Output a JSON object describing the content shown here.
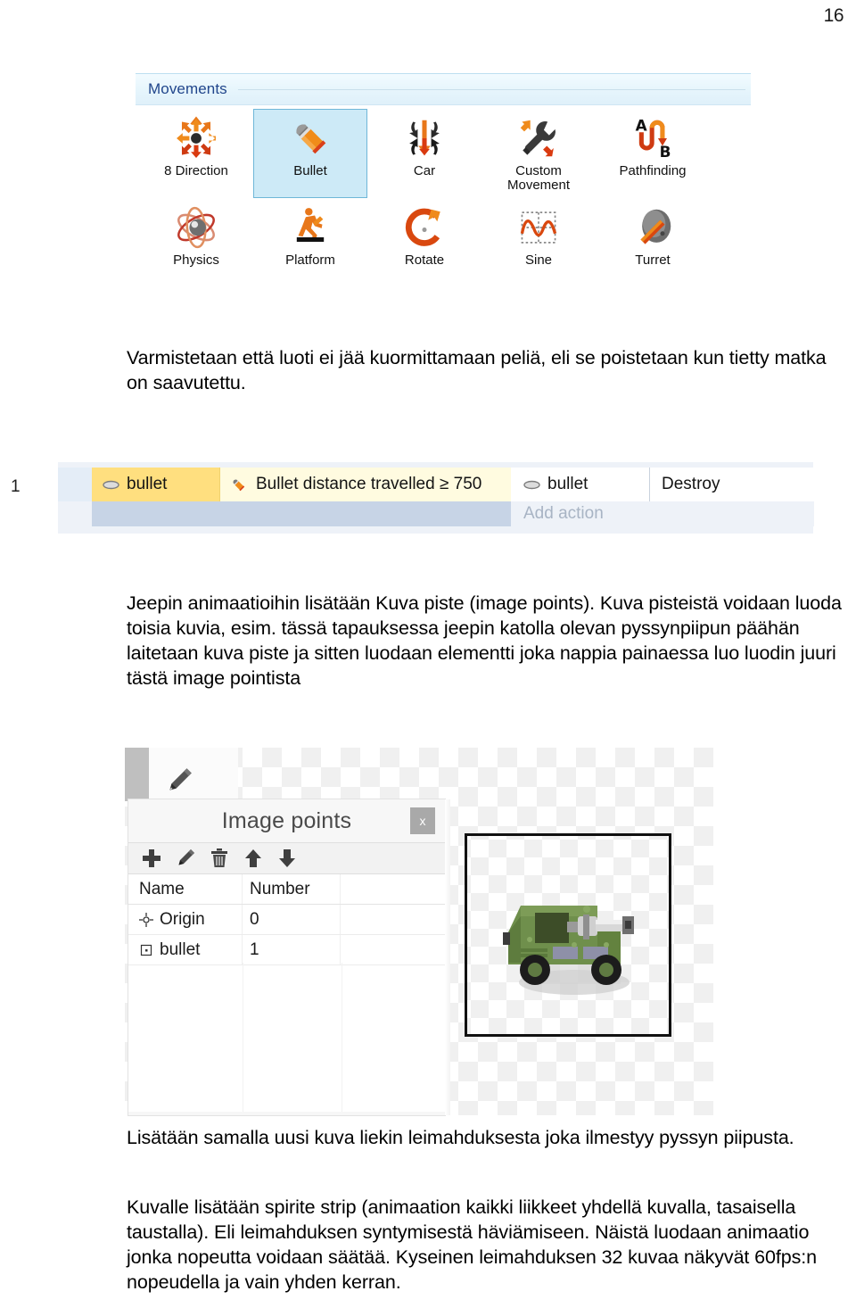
{
  "page": {
    "number": "16"
  },
  "movements_panel": {
    "header": "Movements",
    "items": [
      {
        "label": "8 Direction",
        "icon": "eight-direction-icon",
        "selected": false
      },
      {
        "label": "Bullet",
        "icon": "bullet-icon",
        "selected": true
      },
      {
        "label": "Car",
        "icon": "car-icon",
        "selected": false
      },
      {
        "label": "Custom\nMovement",
        "icon": "custom-movement-icon",
        "selected": false
      },
      {
        "label": "Pathfinding",
        "icon": "pathfinding-icon",
        "selected": false
      },
      {
        "label": "Physics",
        "icon": "physics-icon",
        "selected": false
      },
      {
        "label": "Platform",
        "icon": "platform-icon",
        "selected": false
      },
      {
        "label": "Rotate",
        "icon": "rotate-icon",
        "selected": false
      },
      {
        "label": "Sine",
        "icon": "sine-icon",
        "selected": false
      },
      {
        "label": "Turret",
        "icon": "turret-icon",
        "selected": false
      }
    ]
  },
  "paragraphs": {
    "p1": "Varmistetaan että luoti ei jää kuormittamaan peliä, eli se poistetaan kun tietty matka on saavutettu.",
    "p2": "Jeepin animaatioihin lisätään Kuva piste (image points). Kuva pisteistä voidaan luoda toisia kuvia, esim. tässä tapauksessa jeepin katolla olevan pyssynpiipun päähän laitetaan kuva piste ja sitten luodaan elementti joka nappia painaessa luo luodin juuri tästä image pointista",
    "p3": "Lisätään samalla uusi kuva liekin leimahduksesta joka ilmestyy pyssyn piipusta.",
    "p4": "Kuvalle lisätään spirite strip (animaation kaikki liikkeet yhdellä kuvalla, tasaisella taustalla). Eli leimahduksen syntymisestä häviämiseen. Näistä luodaan animaatio jonka nopeutta voidaan säätää. Kyseinen leimahduksen 32 kuvaa näkyvät 60fps:n nopeudella ja vain yhden kerran."
  },
  "event_sheet": {
    "event_number": "1",
    "condition": {
      "object": "bullet",
      "object_icon": "bullet-object-icon",
      "text": "Bullet distance travelled ≥ 750",
      "icon": "bullet-behavior-icon"
    },
    "action": {
      "object": "bullet",
      "object_icon": "bullet-object-icon",
      "text": "Destroy"
    },
    "add_action_label": "Add action",
    "colors": {
      "condition_bg": "#ffdf7f",
      "condition_text_bg": "#fffbe0",
      "sheet_bg": "#eef2f8",
      "add_row_bg": "#c7d4e6"
    }
  },
  "image_points_dialog": {
    "title": "Image points",
    "close_label": "x",
    "toolbar": [
      {
        "name": "add-image-point",
        "icon": "plus-icon"
      },
      {
        "name": "edit-image-point",
        "icon": "pencil-icon"
      },
      {
        "name": "delete-image-point",
        "icon": "trash-icon"
      },
      {
        "name": "move-up",
        "icon": "arrow-up-icon"
      },
      {
        "name": "move-down",
        "icon": "arrow-down-icon"
      }
    ],
    "columns": [
      "Name",
      "Number"
    ],
    "rows": [
      {
        "name": "Origin",
        "number": "0",
        "icon": "origin-crosshair-icon"
      },
      {
        "name": "bullet",
        "number": "1",
        "icon": "point-square-icon"
      }
    ],
    "preview": {
      "sprite_name": "jeep-sprite",
      "body_color": "#6b8d4a",
      "wheel_color": "#1f1f1f",
      "gun_color": "#c8c8c8"
    }
  }
}
